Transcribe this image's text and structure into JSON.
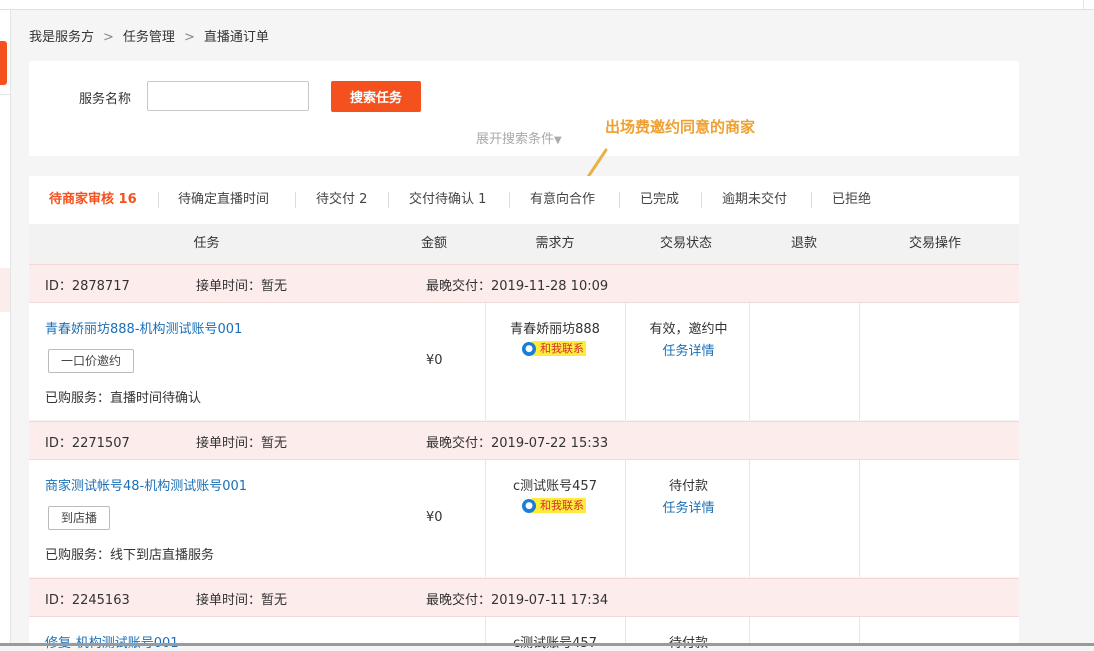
{
  "breadcrumb": {
    "items": [
      "我是服务方",
      "任务管理",
      "直播通订单"
    ],
    "separator": ">"
  },
  "search": {
    "label": "服务名称",
    "placeholder": "",
    "value": "",
    "button": "搜索任务",
    "expand": "展开搜索条件"
  },
  "annotation": {
    "text": "出场费邀约同意的商家"
  },
  "tabs": [
    {
      "label": "待商家审核 16",
      "active": true
    },
    {
      "label": "待确定直播时间"
    },
    {
      "label": "待交付 2"
    },
    {
      "label": "交付待确认 1"
    },
    {
      "label": "有意向合作"
    },
    {
      "label": "已完成"
    },
    {
      "label": "逾期未交付"
    },
    {
      "label": "已拒绝"
    }
  ],
  "table": {
    "headers": [
      "任务",
      "金额",
      "需求方",
      "交易状态",
      "退款",
      "交易操作"
    ]
  },
  "orders": [
    {
      "id": "ID：2878717",
      "accept": "接单时间：暂无",
      "deadline": "最晚交付：2019-11-28 10:09",
      "task": "青春娇丽坊888-机构测试账号001",
      "tag": "一口价邀约",
      "purchased": "已购服务：直播时间待确认",
      "amount": "¥0",
      "buyer": "青春娇丽坊888",
      "contact": "和我联系",
      "status": "有效，邀约中",
      "detail": "任务详情"
    },
    {
      "id": "ID：2271507",
      "accept": "接单时间：暂无",
      "deadline": "最晚交付：2019-07-22 15:33",
      "task": "商家测试帐号48-机构测试账号001",
      "tag": "到店播",
      "purchased": "已购服务：线下到店直播服务",
      "amount": "¥0",
      "buyer": "c测试账号457",
      "contact": "和我联系",
      "status": "待付款",
      "detail": "任务详情"
    },
    {
      "id": "ID：2245163",
      "accept": "接单时间：暂无",
      "deadline": "最晚交付：2019-07-11 17:34",
      "task": "修复-机构测试账号001",
      "buyer": "c测试账号457",
      "status": "待付款"
    }
  ],
  "colors": {
    "accent": "#f4511e",
    "link": "#1a6fb8",
    "order_header_bg": "#fdecec",
    "annotation": "#f0a030"
  }
}
